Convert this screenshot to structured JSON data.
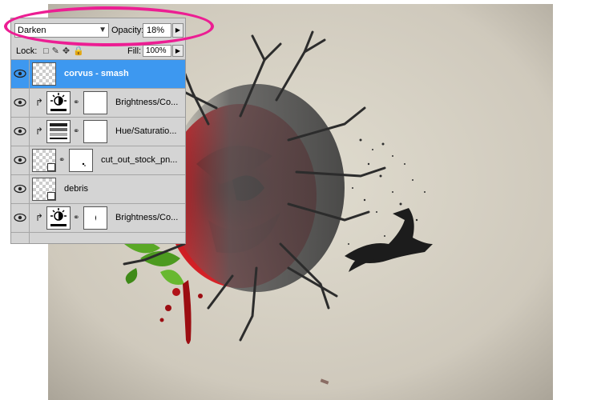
{
  "layers_panel": {
    "blend_mode": "Darken",
    "opacity_label": "Opacity:",
    "opacity_value": "18%",
    "lock_label": "Lock:",
    "fill_label": "Fill:",
    "fill_value": "100%",
    "layers": [
      {
        "name": "corvus - smash",
        "type": "pixel",
        "selected": true
      },
      {
        "name": "Brightness/Co...",
        "type": "adjustment-brightness",
        "clipped": true
      },
      {
        "name": "Hue/Saturatio...",
        "type": "adjustment-hue",
        "clipped": true
      },
      {
        "name": "cut_out_stock_pn...",
        "type": "smart-object-with-mask"
      },
      {
        "name": "debris",
        "type": "smart-object"
      },
      {
        "name": "Brightness/Co...",
        "type": "adjustment-brightness",
        "clipped": true
      }
    ]
  },
  "colors": {
    "selection_blue": "#3d98f0",
    "highlight_magenta": "#ec1e93",
    "rose_red": "#c8141c",
    "leaf_green": "#5aa826",
    "background_parchment": "#d6d1c6"
  }
}
